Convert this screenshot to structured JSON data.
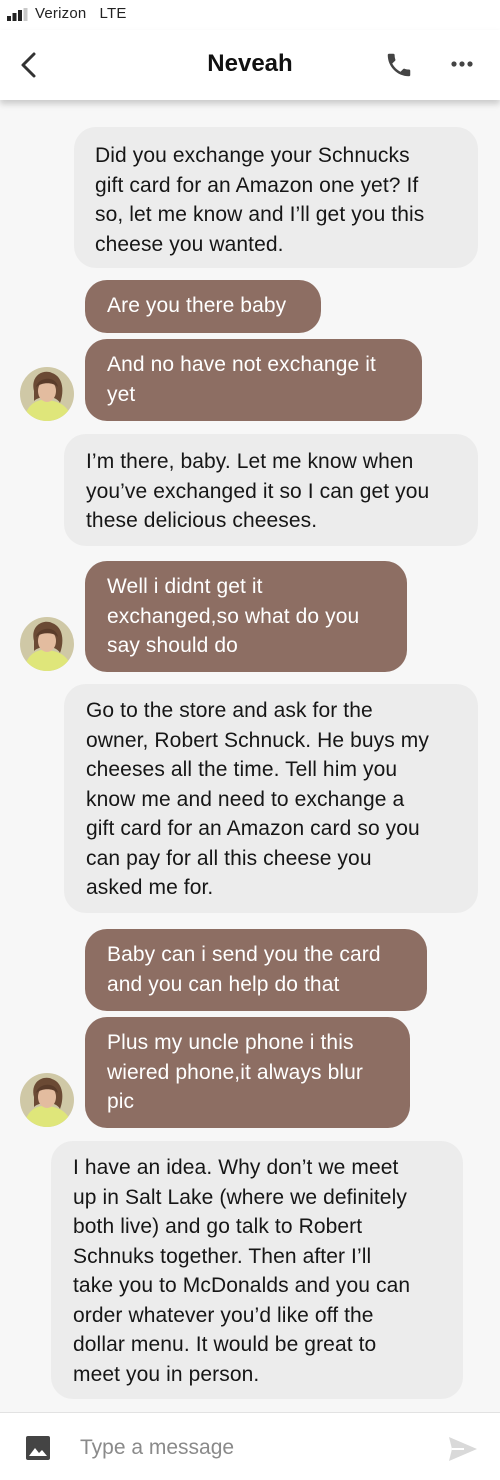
{
  "status_bar": {
    "carrier": "Verizon",
    "network": "LTE",
    "signal_bars": 3
  },
  "header": {
    "contact_name": "Neveah",
    "back_icon": "chevron-left-icon",
    "call_icon": "phone-icon",
    "more_icon": "more-horizontal-icon"
  },
  "theme": {
    "sent_bubble": "#ececec",
    "received_bubble": "#8d6e63",
    "chat_background": "#f7f7f7"
  },
  "messages": [
    {
      "direction": "sent",
      "text": "Did you exchange your Schnucks\ngift card for an Amazon one yet? If\nso, let me know and I’ll get you this\ncheese you wanted."
    },
    {
      "direction": "received",
      "text": "Are you there baby"
    },
    {
      "direction": "received",
      "text": "And no have not exchange it\nyet"
    },
    {
      "direction": "sent",
      "text": "I’m there, baby. Let me know when\nyou’ve exchanged it so I can get you\nthese delicious cheeses."
    },
    {
      "direction": "received",
      "text": "Well i didnt get it\nexchanged,so what do you\nsay should do"
    },
    {
      "direction": "sent",
      "text": "Go to the store and ask for the\nowner, Robert Schnuck. He buys my\ncheeses all the time. Tell him you\nknow me and need to exchange a\ngift card for an Amazon card so you\ncan pay for all this cheese you\nasked me for."
    },
    {
      "direction": "received",
      "text": "Baby can i send you the card\nand you can help do that"
    },
    {
      "direction": "received",
      "text": "Plus my  uncle phone i this\nwiered phone,it always blur\npic"
    },
    {
      "direction": "sent",
      "text": "I have an idea. Why don’t we meet\nup in Salt Lake (where we definitely\nboth live) and go talk to Robert\nSchnuks together. Then after I’ll\ntake you to McDonalds and you can\norder whatever you’d like off the\ndollar menu. It would be great to\nmeet you in person."
    }
  ],
  "composer": {
    "placeholder": "Type a message",
    "image_icon": "image-icon",
    "send_icon": "send-icon"
  }
}
